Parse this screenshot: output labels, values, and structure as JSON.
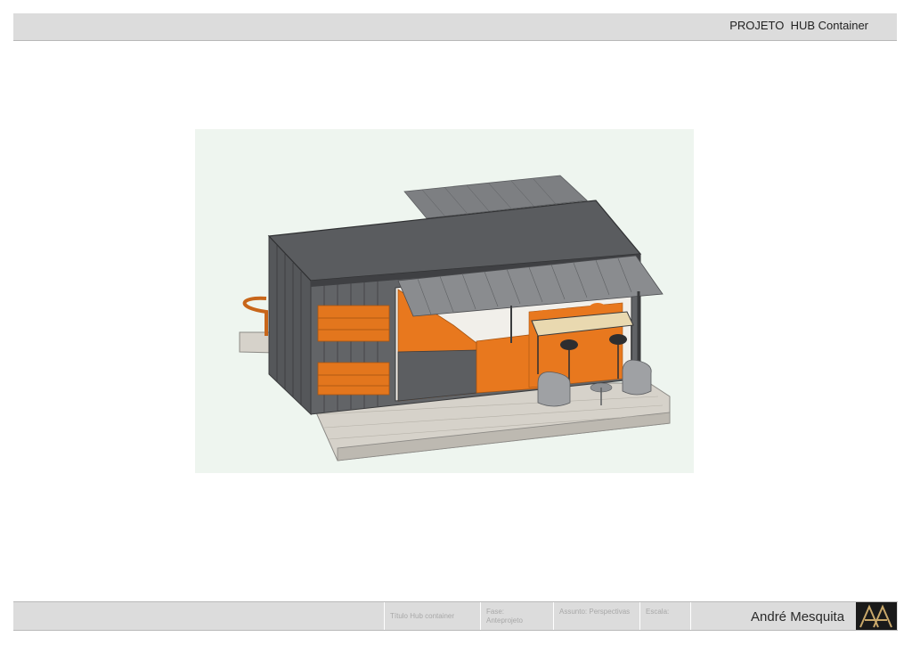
{
  "header": {
    "title": "PROJETO  HUB Container"
  },
  "render": {
    "subject": "Container café isometric perspective",
    "colors": {
      "container": "#5b5d60",
      "roof": "#6b6d70",
      "accent": "#e8781e",
      "deck": "#d8d4cc",
      "background": "#eef5ef"
    }
  },
  "title_block": {
    "title_label": "Título Hub container",
    "phase_label": "Fase:",
    "phase_value": "Anteprojeto",
    "subject_label": "Assunto: Perspectivas",
    "scale_label": "Escala:",
    "author": "André Mesquita"
  }
}
